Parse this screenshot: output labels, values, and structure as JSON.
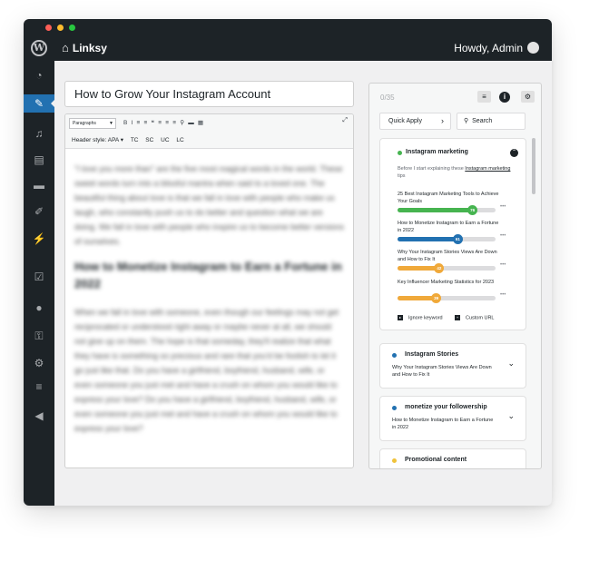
{
  "adminbar": {
    "wp_logo": "W",
    "home_icon": "⌂",
    "site_name": "Linksy",
    "howdy": "Howdy, Admin"
  },
  "window_dots": [
    "#ff5f57",
    "#febc2e",
    "#28c840"
  ],
  "sidebar": {
    "icons": [
      "dashboard-icon",
      "pin-icon",
      "media-icon",
      "pages-icon",
      "comments-icon",
      "appearance-icon",
      "plugins-icon",
      "linksy-icon",
      "users-icon",
      "tools-icon",
      "settings-icon",
      "sliders-icon",
      "collapse-icon"
    ],
    "glyphs": [
      "◔",
      "✎",
      "♫",
      "▤",
      "▬",
      "✐",
      "⚡",
      "☑",
      "●",
      "⚿",
      "⚙",
      "≡",
      "◀"
    ],
    "active_index": 1
  },
  "editor": {
    "title": "How to Grow Your Instagram Account",
    "format_select": "Paragraphs",
    "toolbar_icons": "B I ≡ ≡ ❝ ≡ ≡ ≡ ⚲ ▬ ▦",
    "expand_icon": "⤢",
    "header_style_label": "Header style: APA",
    "header_style_options": [
      "TC",
      "SC",
      "UC",
      "LC"
    ],
    "paragraph1": "\"I love you more than\" are the five most magical words in the world. These sweet words turn into a blissful mantra when said to a loved one. The beautiful thing about love is that we fall in love with people who make us laugh, who constantly push us to do better and question what we are doing. We fall in love with people who inspire us to become better versions of ourselves.",
    "heading": "How to Monetize Instagram to Earn a Fortune in 2022",
    "paragraph2": "When we fall in love with someone, even though our feelings may not get reciprocated or understood right away or maybe never at all, we should not give up on them. The hope is that someday, they'll realize that what they have is something so precious and rare that you'd be foolish to let it go just like that. Do you have a girlfriend, boyfriend, husband, wife, or even someone you just met and have a crush on whom you would like to express your love? Do you have a girlfriend, boyfriend, husband, wife, or even someone you just met and have a crush on whom you would like to express your love?"
  },
  "panel": {
    "count": "0/35",
    "filter_icon": "≡",
    "info_icon": "i",
    "settings_icon": "⚙",
    "quick_apply": "Quick Apply",
    "search": "Search",
    "expanded_keyword": {
      "title": "Instagram marketing",
      "dot_color": "#46b450",
      "desc_prefix": "Before I start explaining these",
      "desc_link": "Instagram marketing",
      "desc_suffix": "tips",
      "suggestions": [
        {
          "title": "25 Best Instagram Marketing Tools to Achieve Your Goals",
          "score": 76,
          "color": "#46b450"
        },
        {
          "title": "How to Monetize Instagram to Earn a Fortune in 2022",
          "score": 61,
          "color": "#2271b1"
        },
        {
          "title": "Why Your Instagram Stories Views Are Down and How to Fix It",
          "score": 42,
          "color": "#f0a93a"
        },
        {
          "title": "Key Influencer Marketing Statistics for 2023",
          "score": 39,
          "color": "#f0a93a"
        }
      ],
      "ignore_label": "Ignore keyword",
      "custom_label": "Custom URL"
    },
    "collapsed": [
      {
        "title": "Instagram Stories",
        "dot_color": "#2271b1",
        "desc": "Why Your Instagram Stories Views Are Down and How to Fix It"
      },
      {
        "title": "monetize your followership",
        "dot_color": "#2271b1",
        "desc": "How to Monetize Instagram to Earn a Fortune in 2022"
      },
      {
        "title": "Promotional content",
        "dot_color": "#f0c33c",
        "desc": "How to Monetize Instagram to Earn a Fortune in 2022"
      }
    ]
  }
}
